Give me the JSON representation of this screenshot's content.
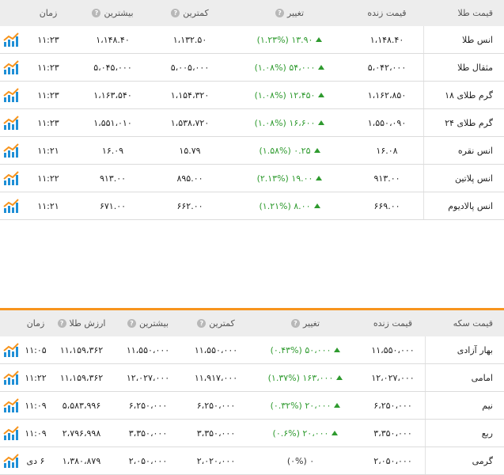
{
  "gold_table": {
    "headers": {
      "name": "قیمت طلا",
      "price": "قیمت زنده",
      "change": "تغییر",
      "low": "کمترین",
      "high": "بیشترین",
      "time": "زمان"
    },
    "rows": [
      {
        "name": "انس طلا",
        "price": "۱،۱۴۸.۴۰",
        "change": "(۱.۲۳%) ۱۳.۹۰",
        "low": "۱،۱۳۲.۵۰",
        "high": "۱،۱۴۸.۴۰",
        "time": "۱۱:۲۳"
      },
      {
        "name": "مثقال طلا",
        "price": "۵،۰۴۲،۰۰۰",
        "change": "(۱.۰۸%) ۵۴،۰۰۰",
        "low": "۵،۰۰۵،۰۰۰",
        "high": "۵،۰۴۵،۰۰۰",
        "time": "۱۱:۲۳"
      },
      {
        "name": "گرم طلای ۱۸",
        "price": "۱،۱۶۲،۸۵۰",
        "change": "(۱.۰۸%) ۱۲،۴۵۰",
        "low": "۱،۱۵۴،۳۲۰",
        "high": "۱،۱۶۳،۵۴۰",
        "time": "۱۱:۲۳"
      },
      {
        "name": "گرم طلای ۲۴",
        "price": "۱،۵۵۰،۰۹۰",
        "change": "(۱.۰۸%) ۱۶،۶۰۰",
        "low": "۱،۵۳۸،۷۲۰",
        "high": "۱،۵۵۱،۰۱۰",
        "time": "۱۱:۲۳"
      },
      {
        "name": "انس نقره",
        "price": "۱۶.۰۸",
        "change": "(۱.۵۸%) ۰.۲۵",
        "low": "۱۵.۷۹",
        "high": "۱۶.۰۹",
        "time": "۱۱:۲۱"
      },
      {
        "name": "انس پلاتین",
        "price": "۹۱۳.۰۰",
        "change": "(۲.۱۳%) ۱۹.۰۰",
        "low": "۸۹۵.۰۰",
        "high": "۹۱۳.۰۰",
        "time": "۱۱:۲۲"
      },
      {
        "name": "انس پالادیوم",
        "price": "۶۶۹.۰۰",
        "change": "(۱.۲۱%) ۸.۰۰",
        "low": "۶۶۲.۰۰",
        "high": "۶۷۱.۰۰",
        "time": "۱۱:۲۱"
      }
    ]
  },
  "coin_table": {
    "headers": {
      "name": "قیمت سکه",
      "price": "قیمت زنده",
      "change": "تغییر",
      "low": "کمترین",
      "high": "بیشترین",
      "gold_value": "ارزش طلا",
      "time": "زمان"
    },
    "rows": [
      {
        "name": "بهار آزادی",
        "price": "۱۱،۵۵۰،۰۰۰",
        "change": "(۰.۴۳%) ۵۰،۰۰۰",
        "low": "۱۱،۵۵۰،۰۰۰",
        "high": "۱۱،۵۵۰،۰۰۰",
        "gold_value": "۱۱،۱۵۹،۳۶۲",
        "time": "۱۱:۰۵",
        "up": true
      },
      {
        "name": "امامی",
        "price": "۱۲،۰۲۷،۰۰۰",
        "change": "(۱.۳۷%) ۱۶۳،۰۰۰",
        "low": "۱۱،۹۱۷،۰۰۰",
        "high": "۱۲،۰۲۷،۰۰۰",
        "gold_value": "۱۱،۱۵۹،۳۶۲",
        "time": "۱۱:۲۲",
        "up": true
      },
      {
        "name": "نیم",
        "price": "۶،۲۵۰،۰۰۰",
        "change": "(۰.۳۲%) ۲۰،۰۰۰",
        "low": "۶،۲۵۰،۰۰۰",
        "high": "۶،۲۵۰،۰۰۰",
        "gold_value": "۵،۵۸۳،۹۹۶",
        "time": "۱۱:۰۹",
        "up": true
      },
      {
        "name": "ربع",
        "price": "۳،۳۵۰،۰۰۰",
        "change": "(۰.۶%) ۲۰،۰۰۰",
        "low": "۳،۳۵۰،۰۰۰",
        "high": "۳،۳۵۰،۰۰۰",
        "gold_value": "۲،۷۹۶،۹۹۸",
        "time": "۱۱:۰۹",
        "up": true
      },
      {
        "name": "گرمی",
        "price": "۲،۰۵۰،۰۰۰",
        "change": "(۰%) ۰",
        "low": "۲،۰۲۰،۰۰۰",
        "high": "۲،۰۵۰،۰۰۰",
        "gold_value": "۱،۳۸۰،۸۷۹",
        "time": "۶ دی",
        "up": false
      }
    ]
  },
  "help_icon": "?",
  "colors": {
    "accent": "#f7941d",
    "positive": "#2e9a2e",
    "header_bg": "#ededed",
    "chart_icon": "#1f8fd6"
  },
  "chart_icon_name": "mini-chart-icon"
}
